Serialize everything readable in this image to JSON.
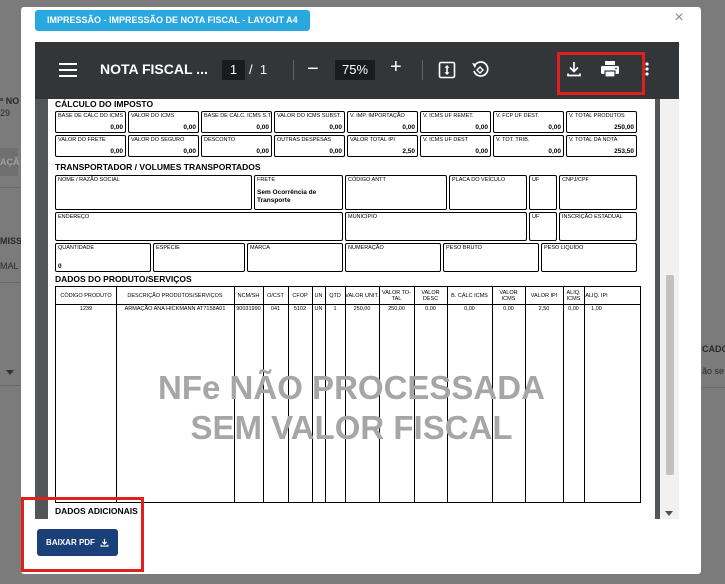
{
  "background": {
    "fragments": [
      "º NO",
      "29",
      "AÇÃ",
      "MISS",
      "MAL",
      "CADOR",
      "ão se"
    ]
  },
  "modal": {
    "title": "IMPRESSÃO - IMPRESSÃO DE NOTA FISCAL - LAYOUT A4",
    "close_label": "×"
  },
  "viewer": {
    "doc_title": "NOTA FISCAL ...",
    "current_page": "1",
    "page_sep": "/",
    "total_pages": "1",
    "zoom": "75%",
    "minus_label": "−",
    "plus_label": "+"
  },
  "invoice": {
    "sec_imposto": "CÁLCULO DO IMPOSTO",
    "imposto_row1": [
      {
        "label": "BASE DE CÁLC DO ICMS",
        "value": "0,00"
      },
      {
        "label": "VALOR DO ICMS",
        "value": "0,00"
      },
      {
        "label": "BASE DE CÁLC. ICMS S.T",
        "value": "0,00"
      },
      {
        "label": "VALOR DO ICMS SUBST.",
        "value": "0,00"
      },
      {
        "label": "V. IMP. IMPORTAÇÃO",
        "value": "0,00"
      },
      {
        "label": "V. ICMS UF REMET.",
        "value": "0,00"
      },
      {
        "label": "V. FCP UF DEST.",
        "value": "0,00"
      },
      {
        "label": "V. TOTAL PRODUTOS",
        "value": "250,00"
      }
    ],
    "imposto_row2": [
      {
        "label": "VALOR DO FRETE",
        "value": "0,00"
      },
      {
        "label": "VALOR DO SEGURO",
        "value": "0,00"
      },
      {
        "label": "DESCONTO",
        "value": "0,00"
      },
      {
        "label": "OUTRAS DESPESAS",
        "value": "0,00"
      },
      {
        "label": "VALOR TOTAL IPI",
        "value": "2,50"
      },
      {
        "label": "V. ICMS UF DEST",
        "value": "0,00"
      },
      {
        "label": "V. TOT. TRIB.",
        "value": "0,00"
      },
      {
        "label": "V. TOTAL DA NOTA",
        "value": "253,50"
      }
    ],
    "sec_transportador": "TRANSPORTADOR / VOLUMES TRANSPORTADOS",
    "transp": {
      "nome_label": "NOME / RAZÃO SOCIAL",
      "frete_label": "FRETE",
      "frete_value": "Sem Ocorrência de Transporte",
      "antt_label": "CÓDIGO ANTT",
      "placa_label": "PLACA DO VEÍCULO",
      "uf_label": "UF",
      "cnpj_label": "CNPJ/CPF",
      "endereco_label": "ENDEREÇO",
      "municipio_label": "MUNICÍPIO",
      "uf2_label": "UF",
      "ie_label": "INSCRIÇÃO ESTADUAL",
      "qtd_label": "QUANTIDADE",
      "qtd_value": "0",
      "especie_label": "ESPÉCIE",
      "marca_label": "MARCA",
      "numeracao_label": "NUMERAÇÃO",
      "pbruto_label": "PESO BRUTO",
      "pliquido_label": "PESO LIQUÍDO"
    },
    "sec_produtos": "DADOS DO PRODUTO/SERVIÇOS",
    "prod_headers": [
      "CÓDIGO PRODUTO",
      "DESCRIÇÃO PRODUTOS/SERVIÇOS",
      "NCM/SH",
      "O/CST",
      "CFOP",
      "UN",
      "QTD",
      "VALOR UNIT.",
      "VALOR TO-TAL",
      "VALOR DESC",
      "B. CÁLC ICMS",
      "VALOR ICMS",
      "VALOR IPI",
      "ALIQ. ICMS",
      "ALIQ. IPI"
    ],
    "prod_row": [
      "1239",
      "ARMAÇÃO ANA HICKMANN AT7158A01",
      "90031990",
      "041",
      "5102",
      "UN",
      "1",
      "250,00",
      "250,00",
      "0,00",
      "0,00",
      "0,00",
      "2,50",
      "0,00",
      "1,00"
    ],
    "watermark_line1": "NFe NÃO PROCESSADA",
    "watermark_line2": "SEM VALOR FISCAL",
    "sec_adicionais": "DADOS ADICIONAIS"
  },
  "footer": {
    "download_button": "BAIXAR PDF"
  },
  "colors": {
    "title_badge": "#29a8e0",
    "download_button": "#1b3f78",
    "highlight": "#e0201c",
    "toolbar": "#323639"
  }
}
